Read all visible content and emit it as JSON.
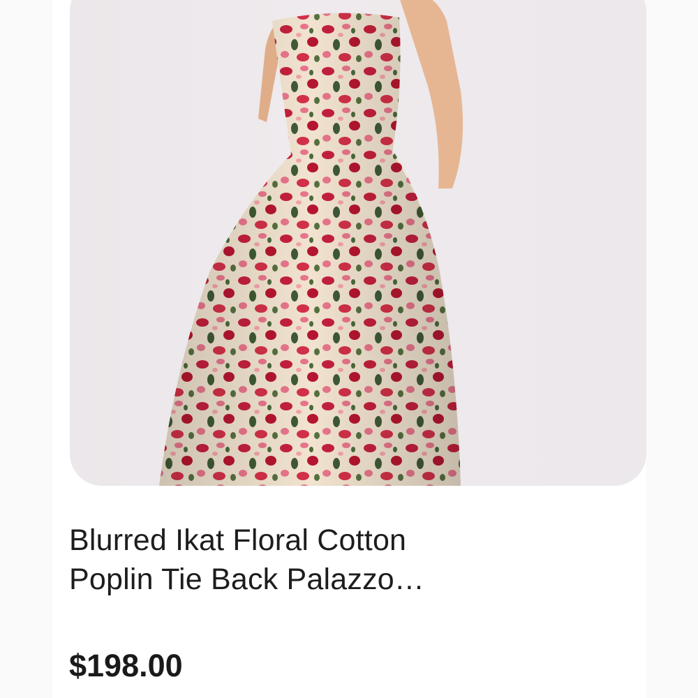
{
  "product": {
    "image": {
      "alt": "Strapless floral print gown",
      "icon": "product-photo",
      "colors": {
        "background": "#ece8eb",
        "fabric_base": "#f1e3cf",
        "fabric_red": "#c4203c",
        "fabric_pink": "#e8758b",
        "fabric_green": "#3f5a34",
        "skin": "#e6b693"
      }
    },
    "title_line_1": "Blurred Ikat Floral Cotton",
    "title_line_2": "Poplin Tie Back Palazzo…",
    "price": "$198.00"
  }
}
